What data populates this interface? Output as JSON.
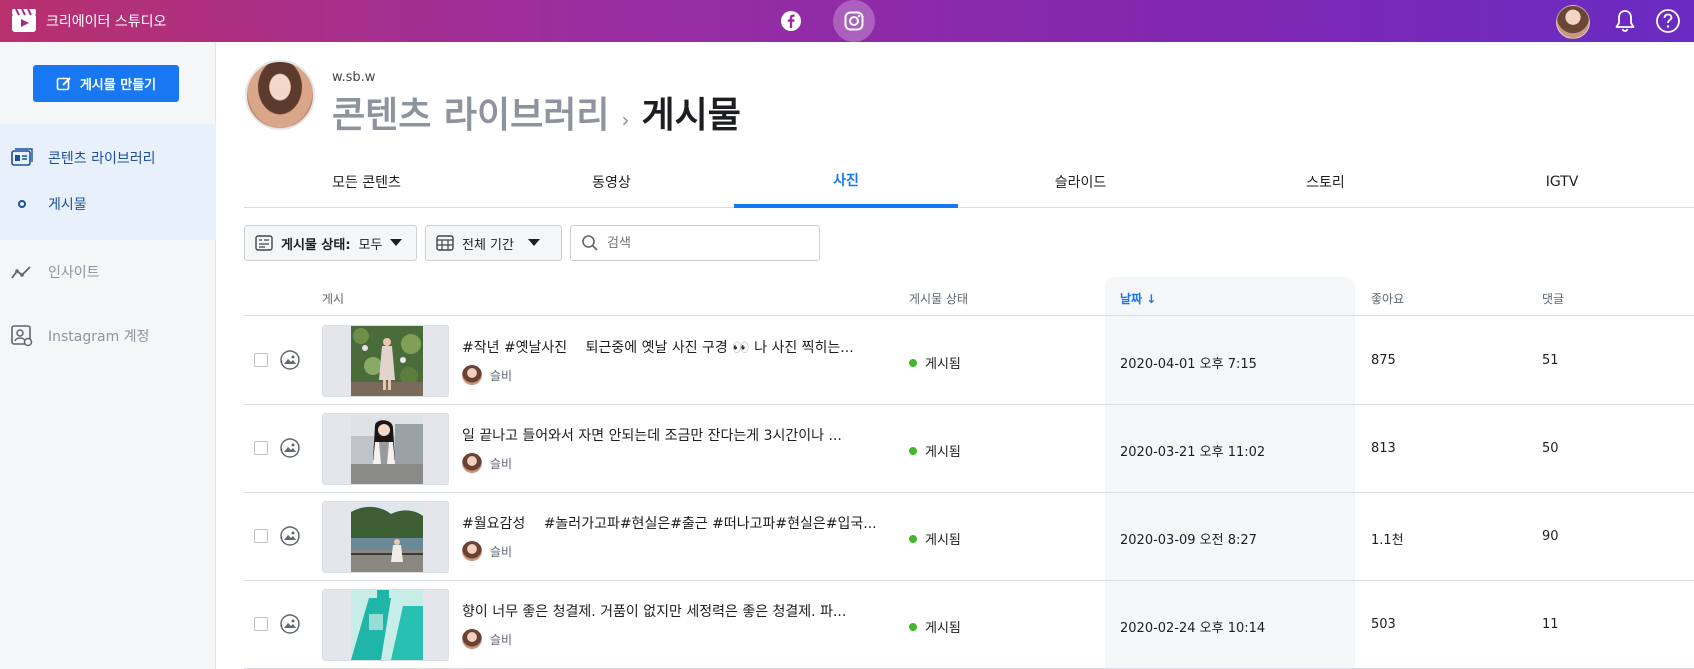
{
  "app": {
    "title": "크리에이터 스튜디오"
  },
  "topbar": {
    "icons": [
      "facebook-icon",
      "instagram-icon",
      "bell-icon",
      "help-icon"
    ]
  },
  "sidebar": {
    "create_label": "게시물 만들기",
    "items": [
      {
        "label": "콘텐츠 라이브러리",
        "icon": "content-library-icon",
        "active": true
      },
      {
        "label": "게시물",
        "icon": "circle-dot-icon",
        "active": true
      },
      {
        "label": "인사이트",
        "icon": "insights-icon",
        "active": false
      },
      {
        "label": "Instagram 계정",
        "icon": "account-settings-icon",
        "active": false
      }
    ]
  },
  "header": {
    "username": "w.sb.w",
    "breadcrumb_parent": "콘텐츠 라이브러리",
    "breadcrumb_sep": "›",
    "breadcrumb_current": "게시물"
  },
  "tabs": [
    {
      "label": "모든 콘텐츠"
    },
    {
      "label": "동영상"
    },
    {
      "label": "사진",
      "active": true
    },
    {
      "label": "슬라이드"
    },
    {
      "label": "스토리"
    },
    {
      "label": "IGTV"
    }
  ],
  "filters": {
    "status_label": "게시물 상태:",
    "status_value": "모두",
    "period_label": "전체 기간",
    "search_placeholder": "검색"
  },
  "table": {
    "columns": {
      "post": "게시",
      "status": "게시물 상태",
      "date": "날짜",
      "likes": "좋아요",
      "comments": "댓글"
    },
    "rows": [
      {
        "caption": "#작년 #옛날사진 　퇴근중에 옛날 사진 구경 👀 나 사진 찍히는...",
        "author": "슬비",
        "status": "게시됨",
        "date": "2020-04-01 오후 7:15",
        "likes": "875",
        "comments": "51"
      },
      {
        "caption": "일 끝나고 들어와서 자면 안되는데 조금만 잔다는게 3시간이나 ...",
        "author": "슬비",
        "status": "게시됨",
        "date": "2020-03-21 오후 11:02",
        "likes": "813",
        "comments": "50"
      },
      {
        "caption": "#월요감성 　#놀러가고파#현실은#출근 #떠나고파#현실은#입국...",
        "author": "슬비",
        "status": "게시됨",
        "date": "2020-03-09 오전 8:27",
        "likes": "1.1천",
        "comments": "90"
      },
      {
        "caption": "향이 너무 좋은 청결제. 거품이 없지만 세정력은 좋은 청결제. 파...",
        "author": "슬비",
        "status": "게시됨",
        "date": "2020-02-24 오후 10:14",
        "likes": "503",
        "comments": "11"
      }
    ]
  },
  "colors": {
    "accent": "#1877f2",
    "status_green": "#42b72a",
    "topbar_start": "#b8306e",
    "topbar_end": "#6a2bc2"
  }
}
